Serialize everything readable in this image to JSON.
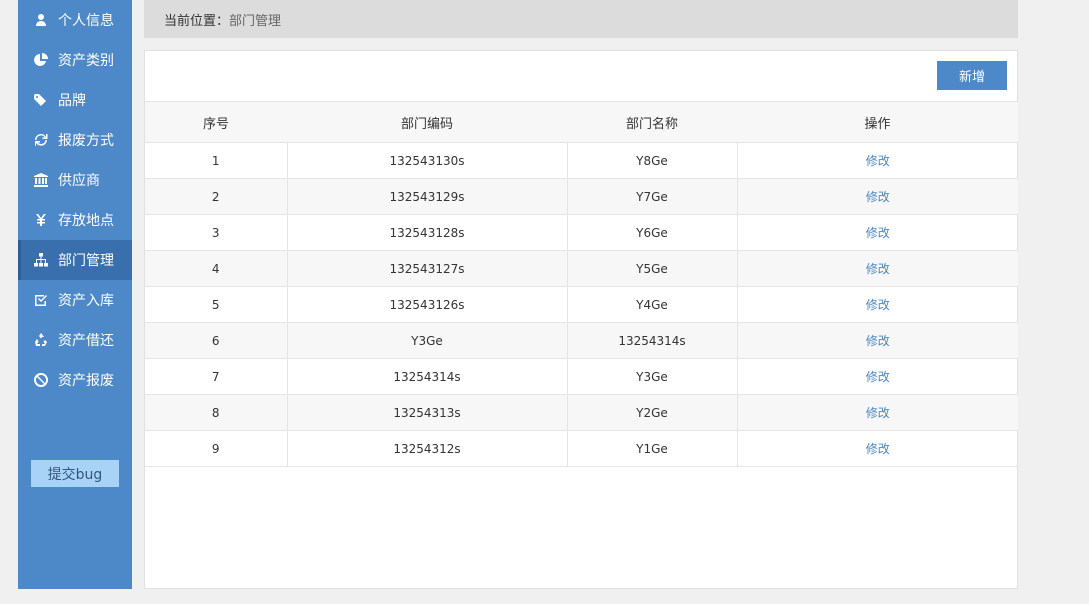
{
  "sidebar": {
    "items": [
      {
        "label": "个人信息",
        "icon": "user-icon"
      },
      {
        "label": "资产类别",
        "icon": "pie-chart-icon"
      },
      {
        "label": "品牌",
        "icon": "tags-icon"
      },
      {
        "label": "报废方式",
        "icon": "refresh-icon"
      },
      {
        "label": "供应商",
        "icon": "bank-icon"
      },
      {
        "label": "存放地点",
        "icon": "yen-icon"
      },
      {
        "label": "部门管理",
        "icon": "sitemap-icon"
      },
      {
        "label": "资产入库",
        "icon": "check-square-icon"
      },
      {
        "label": "资产借还",
        "icon": "recycle-icon"
      },
      {
        "label": "资产报废",
        "icon": "ban-icon"
      }
    ],
    "active_index": 6,
    "bug_label": "提交bug"
  },
  "breadcrumb": {
    "label": "当前位置：",
    "value": "部门管理"
  },
  "toolbar": {
    "add_label": "新增"
  },
  "table": {
    "headers": [
      "序号",
      "部门编码",
      "部门名称",
      "操作"
    ],
    "rows": [
      {
        "no": "1",
        "code": "132543130s",
        "name": "Y8Ge",
        "action": "修改"
      },
      {
        "no": "2",
        "code": "132543129s",
        "name": "Y7Ge",
        "action": "修改"
      },
      {
        "no": "3",
        "code": "132543128s",
        "name": "Y6Ge",
        "action": "修改"
      },
      {
        "no": "4",
        "code": "132543127s",
        "name": "Y5Ge",
        "action": "修改"
      },
      {
        "no": "5",
        "code": "132543126s",
        "name": "Y4Ge",
        "action": "修改"
      },
      {
        "no": "6",
        "code": "Y3Ge",
        "name": "13254314s",
        "action": "修改"
      },
      {
        "no": "7",
        "code": "13254314s",
        "name": "Y3Ge",
        "action": "修改"
      },
      {
        "no": "8",
        "code": "13254313s",
        "name": "Y2Ge",
        "action": "修改"
      },
      {
        "no": "9",
        "code": "13254312s",
        "name": "Y1Ge",
        "action": "修改"
      }
    ]
  },
  "colors": {
    "accent": "#4d88c8",
    "sidebar_active": "#3a6fad",
    "bug_button": "#a9d2f7"
  }
}
